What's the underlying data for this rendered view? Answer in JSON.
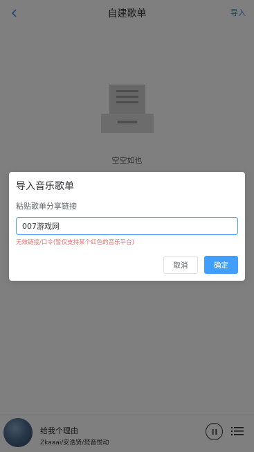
{
  "header": {
    "title": "自建歌单",
    "import_label": "导入",
    "back_icon": "chevron-left-icon"
  },
  "empty": {
    "text": "空空如也",
    "icon": "empty-box-icon"
  },
  "player": {
    "song_title": "给我个理由",
    "artist": "Zkaaai/安浩贤/焚音悦动",
    "pause_icon": "pause-icon",
    "list_icon": "playlist-icon"
  },
  "dialog": {
    "title": "导入音乐歌单",
    "label": "粘贴歌单分享链接",
    "input_value": "007游戏网",
    "error": "无效链接/口令(暂仅支持某个红色的音乐平台)",
    "cancel_label": "取消",
    "confirm_label": "确定"
  },
  "colors": {
    "accent": "#409eff",
    "error": "#f56c6c",
    "header_link": "#3a8ee6"
  }
}
